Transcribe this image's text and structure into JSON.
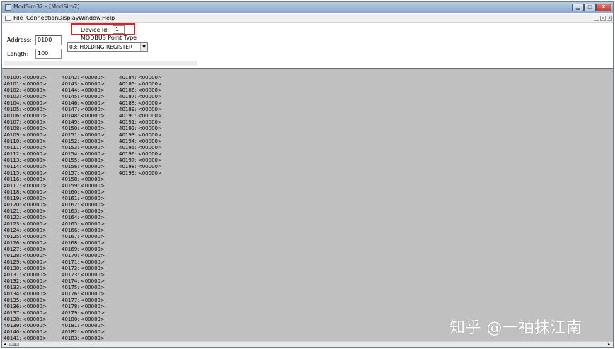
{
  "window": {
    "title": "ModSim32 - [ModSim7]",
    "controls": {
      "minimize": "▁",
      "maximize": "□",
      "close": "X"
    }
  },
  "menu": {
    "items": [
      "File",
      "Connection",
      "Display",
      "Window",
      "Help"
    ],
    "mdi_controls": {
      "minimize": "_",
      "restore": "▫",
      "close": "x"
    }
  },
  "panel": {
    "device_id_label": "Device Id:",
    "device_id_value": "1",
    "address_label": "Address:",
    "address_value": "0100",
    "length_label": "Length:",
    "length_value": "100",
    "point_type_label": "MODBUS Point Type",
    "point_type_value": "03: HOLDING REGISTER"
  },
  "registers": {
    "columns": [
      [
        "40100: <00000>",
        "40101: <00000>",
        "40102: <00000>",
        "40103: <00000>",
        "40104: <00000>",
        "40105: <00000>",
        "40106: <00000>",
        "40107: <00000>",
        "40108: <00000>",
        "40109: <00000>",
        "40110: <00000>",
        "40111: <00000>",
        "40112: <00000>",
        "40113: <00000>",
        "40114: <00000>",
        "40115: <00000>",
        "40116: <00000>",
        "40117: <00000>",
        "40118: <00000>",
        "40119: <00000>",
        "40120: <00000>",
        "40121: <00000>",
        "40122: <00000>",
        "40123: <00000>",
        "40124: <00000>",
        "40125: <00000>",
        "40126: <00000>",
        "40127: <00000>",
        "40128: <00000>",
        "40129: <00000>",
        "40130: <00000>",
        "40131: <00000>",
        "40132: <00000>",
        "40133: <00000>",
        "40134: <00000>",
        "40135: <00000>",
        "40136: <00000>",
        "40137: <00000>",
        "40138: <00000>",
        "40139: <00000>",
        "40140: <00000>",
        "40141: <00000>"
      ],
      [
        "40142: <00000>",
        "40143: <00000>",
        "40144: <00000>",
        "40145: <00000>",
        "40146: <00000>",
        "40147: <00000>",
        "40148: <00000>",
        "40149: <00000>",
        "40150: <00000>",
        "40151: <00000>",
        "40152: <00000>",
        "40153: <00000>",
        "40154: <00000>",
        "40155: <00000>",
        "40156: <00000>",
        "40157: <00000>",
        "40158: <00000>",
        "40159: <00000>",
        "40160: <00000>",
        "40161: <00000>",
        "40162: <00000>",
        "40163: <00000>",
        "40164: <00000>",
        "40165: <00000>",
        "40166: <00000>",
        "40167: <00000>",
        "40168: <00000>",
        "40169: <00000>",
        "40170: <00000>",
        "40171: <00000>",
        "40172: <00000>",
        "40173: <00000>",
        "40174: <00000>",
        "40175: <00000>",
        "40176: <00000>",
        "40177: <00000>",
        "40178: <00000>",
        "40179: <00000>",
        "40180: <00000>",
        "40181: <00000>",
        "40182: <00000>",
        "40183: <00000>"
      ],
      [
        "40184: <00000>",
        "40185: <00000>",
        "40186: <00000>",
        "40187: <00000>",
        "40188: <00000>",
        "40189: <00000>",
        "40190: <00000>",
        "40191: <00000>",
        "40192: <00000>",
        "40193: <00000>",
        "40194: <00000>",
        "40195: <00000>",
        "40196: <00000>",
        "40197: <00000>",
        "40198: <00000>",
        "40199: <00000>"
      ]
    ]
  },
  "watermark": "知乎 @一袖抹江南",
  "scrollbar": {
    "left_arrow": "◂",
    "thumb_grip": "|||",
    "right_arrow": "▸"
  },
  "icons": {
    "app": "app-icon",
    "document": "document-icon",
    "dropdown": "chevron-down-icon"
  },
  "colors": {
    "highlight_box": "#d2262c",
    "grid_background": "#c0c0c0"
  }
}
